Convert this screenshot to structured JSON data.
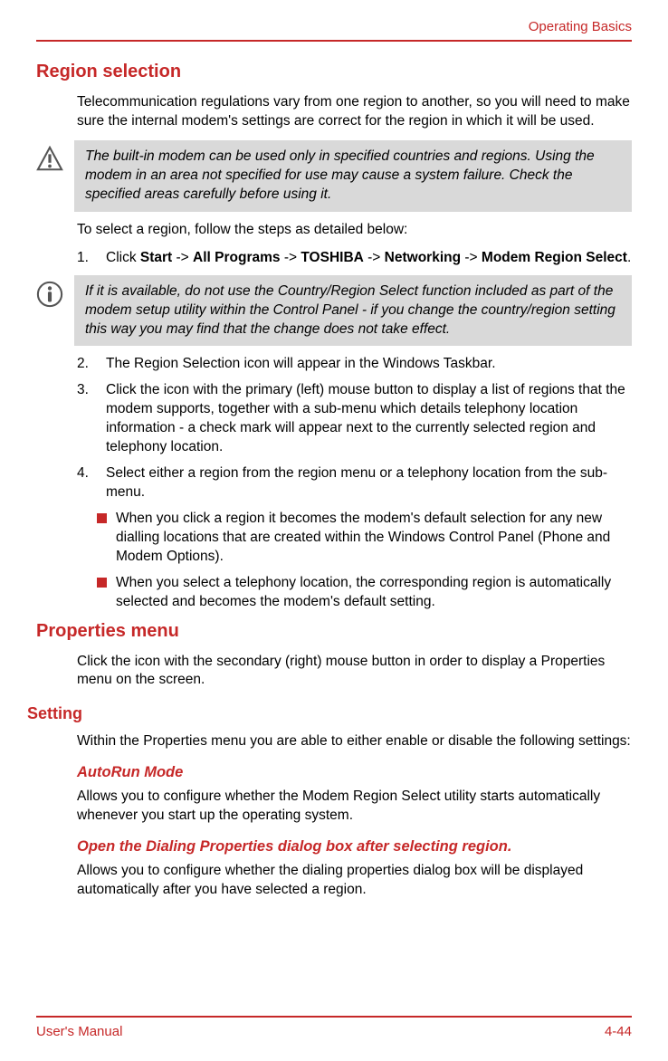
{
  "header": {
    "section": "Operating Basics"
  },
  "h2": "Region selection",
  "p1": "Telecommunication regulations vary from one region to another, so you will need to make sure the internal modem's settings are correct for the region in which it will be used.",
  "callout1": "The built-in modem can be used only in specified countries and regions. Using the modem in an area not specified for use may cause a system failure. Check the specified areas carefully before using it.",
  "p2": "To select a region, follow the steps as detailed below:",
  "step1": {
    "num": "1.",
    "pre": "Click ",
    "nav": [
      "Start",
      "All Programs",
      "TOSHIBA",
      "Networking",
      "Modem Region Select"
    ],
    "sep": " -> ",
    "post": "."
  },
  "callout2": "If it is available, do not use the Country/Region Select function included as part of the modem setup utility within the Control Panel - if you change the country/region setting this way you may find that the change does not take effect.",
  "step2": {
    "num": "2.",
    "text": "The Region Selection icon will appear in the Windows Taskbar."
  },
  "step3": {
    "num": "3.",
    "text": "Click the icon with the primary (left) mouse button to display a list of regions that the modem supports, together with a sub-menu which details telephony location information - a check mark will appear next to the currently selected region and telephony location."
  },
  "step4": {
    "num": "4.",
    "text": "Select either a region from the region menu or a telephony location from the sub-menu."
  },
  "step4_b1": "When you click a region it becomes the modem's default selection for any new dialling locations that are created within the Windows Control Panel (Phone and Modem Options).",
  "step4_b2": "When you select a telephony location, the corresponding region is automatically selected and becomes the modem's default setting.",
  "h2b": "Properties menu",
  "p3": "Click the icon with the secondary (right) mouse button in order to display a Properties menu on the screen.",
  "h3a": "Setting",
  "p4": "Within the Properties menu you are able to either enable or disable the following settings:",
  "h4a": "AutoRun Mode",
  "p5": "Allows you to configure whether the Modem Region Select utility starts automatically whenever you start up the operating system.",
  "h4b": "Open the Dialing Properties dialog box after selecting region.",
  "p6": "Allows you to configure whether the dialing properties dialog box will be displayed automatically after you have selected a region.",
  "footer": {
    "left": "User's Manual",
    "right": "4-44"
  }
}
